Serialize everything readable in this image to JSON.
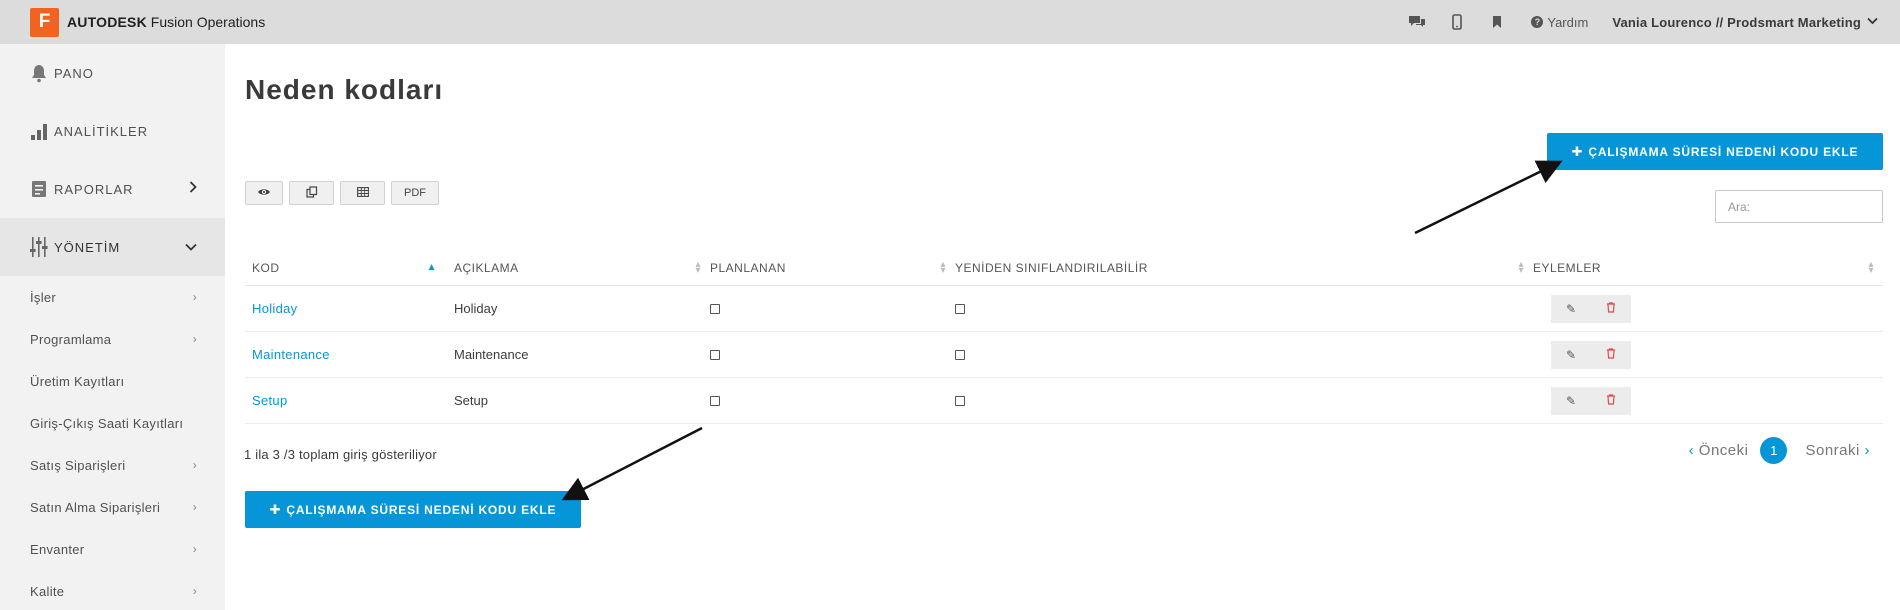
{
  "header": {
    "logo_letter": "F",
    "brand_bold": "AUTODESK",
    "brand_rest": "Fusion Operations",
    "help_label": "Yardım",
    "user_label": "Vania Lourenco // Prodsmart Marketing",
    "icons": [
      "chat-icon",
      "mobile-icon",
      "bookmark-icon",
      "help-icon"
    ]
  },
  "sidebar": {
    "main": [
      {
        "label": "PANO",
        "icon": "bell-icon"
      },
      {
        "label": "ANALİTİKLER",
        "icon": "bar-chart-icon"
      },
      {
        "label": "RAPORLAR",
        "icon": "report-icon"
      },
      {
        "label": "YÖNETİM",
        "icon": "sliders-icon"
      }
    ],
    "sub": [
      {
        "label": "İşler"
      },
      {
        "label": "Programlama"
      },
      {
        "label": "Üretim Kayıtları"
      },
      {
        "label": "Giriş-Çıkış Saati Kayıtları"
      },
      {
        "label": "Satış Siparişleri"
      },
      {
        "label": "Satın Alma Siparişleri"
      },
      {
        "label": "Envanter"
      },
      {
        "label": "Kalite"
      }
    ]
  },
  "main": {
    "title": "Neden kodları",
    "add_button": "ÇALIŞMAMA SÜRESİ NEDENİ KODU EKLE",
    "tools": {
      "pdf_label": "PDF"
    },
    "search": {
      "placeholder": "Ara:",
      "value": ""
    },
    "table": {
      "headers": [
        "KOD",
        "AÇIKLAMA",
        "PLANLANAN",
        "YENİDEN SINIFLANDIRILABİLİR",
        "EYLEMLER"
      ],
      "rows": [
        {
          "code": "Holiday",
          "description": "Holiday",
          "planned": false,
          "reclassifiable": false
        },
        {
          "code": "Maintenance",
          "description": "Maintenance",
          "planned": false,
          "reclassifiable": false
        },
        {
          "code": "Setup",
          "description": "Setup",
          "planned": false,
          "reclassifiable": false
        }
      ]
    },
    "info": "1 ila 3 /3 toplam giriş gösteriliyor",
    "pagination": {
      "prev": "Önceki",
      "current": "1",
      "next": "Sonraki"
    }
  },
  "colors": {
    "accent": "#0696d7",
    "brand": "#f26322",
    "danger": "#e04a4a"
  }
}
